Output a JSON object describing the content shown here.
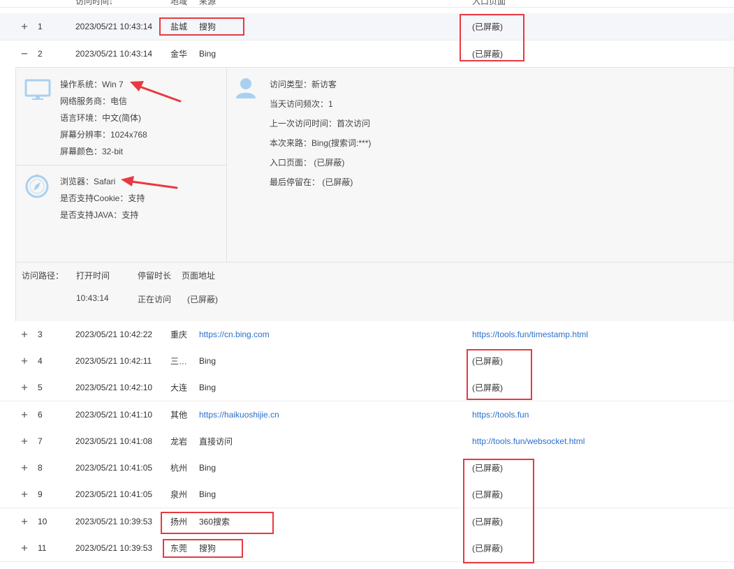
{
  "header": {
    "time_label": "访问时间",
    "sort_arrow": "↓",
    "region_label": "地域",
    "source_label": "来源",
    "entry_label": "入口页面"
  },
  "rows": [
    {
      "toggle": "+",
      "num": "1",
      "time": "2023/05/21 10:43:14",
      "region": "盐城",
      "source": "搜狗",
      "entry": "(已屏蔽)"
    },
    {
      "toggle": "−",
      "num": "2",
      "time": "2023/05/21 10:43:14",
      "region": "金华",
      "source": "Bing",
      "entry": "(已屏蔽)"
    },
    {
      "toggle": "+",
      "num": "3",
      "time": "2023/05/21 10:42:22",
      "region": "重庆",
      "source": "https://cn.bing.com",
      "entry": "https://tools.fun/timestamp.html"
    },
    {
      "toggle": "+",
      "num": "4",
      "time": "2023/05/21 10:42:11",
      "region": "三…",
      "source": "Bing",
      "entry": "(已屏蔽)"
    },
    {
      "toggle": "+",
      "num": "5",
      "time": "2023/05/21 10:42:10",
      "region": "大连",
      "source": "Bing",
      "entry": "(已屏蔽)"
    },
    {
      "toggle": "+",
      "num": "6",
      "time": "2023/05/21 10:41:10",
      "region": "其他",
      "source": "https://haikuoshijie.cn",
      "entry": "https://tools.fun"
    },
    {
      "toggle": "+",
      "num": "7",
      "time": "2023/05/21 10:41:08",
      "region": "龙岩",
      "source": "直接访问",
      "entry": "http://tools.fun/websocket.html"
    },
    {
      "toggle": "+",
      "num": "8",
      "time": "2023/05/21 10:41:05",
      "region": "杭州",
      "source": "Bing",
      "entry": "(已屏蔽)"
    },
    {
      "toggle": "+",
      "num": "9",
      "time": "2023/05/21 10:41:05",
      "region": "泉州",
      "source": "Bing",
      "entry": "(已屏蔽)"
    },
    {
      "toggle": "+",
      "num": "10",
      "time": "2023/05/21 10:39:53",
      "region": "扬州",
      "source": "360搜索",
      "entry": "(已屏蔽)"
    },
    {
      "toggle": "+",
      "num": "11",
      "time": "2023/05/21 10:39:53",
      "region": "东莞",
      "source": "搜狗",
      "entry": "(已屏蔽)"
    }
  ],
  "detail": {
    "system": {
      "os": "操作系统：Win 7",
      "isp": "网络服务商：电信",
      "lang": "语言环境：中文(简体)",
      "resolution": "屏幕分辨率：1024x768",
      "color": "屏幕颜色：32-bit"
    },
    "browser": {
      "name": "浏览器：Safari",
      "cookie": "是否支持Cookie：支持",
      "java": "是否支持JAVA：支持"
    },
    "visitor": {
      "type": "访问类型：新访客",
      "freq": "当天访问频次：1",
      "last": "上一次访问时间：首次访问",
      "from": "本次来路：Bing(搜索词:***)",
      "entry": "入口页面：  (已屏蔽)",
      "stay": "最后停留在：  (已屏蔽)"
    },
    "path": {
      "label": "访问路径：",
      "col_open": "打开时间",
      "col_stay": "停留时长",
      "col_url": "页面地址",
      "open": "10:43:14",
      "stay": "正在访问",
      "url": "(已屏蔽)"
    }
  },
  "colors": {
    "annotation": "#e8393f",
    "link": "#2a6fcf",
    "highlight_row": "#f4f6fa"
  }
}
